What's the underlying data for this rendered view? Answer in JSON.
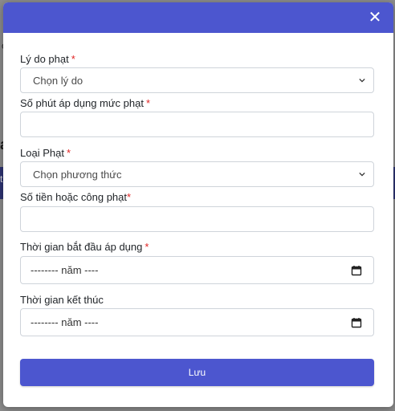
{
  "modal": {
    "close_symbol": "✕",
    "fields": [
      {
        "label": "Lý do phạt",
        "required_mark": "*",
        "type": "select",
        "selected": "Chọn lý do"
      },
      {
        "label": "Số phút áp dụng mức phạt",
        "required_mark": "*",
        "type": "text",
        "value": ""
      },
      {
        "label": "Loại Phạt",
        "required_mark": "*",
        "type": "select",
        "selected": "Chọn phương thức"
      },
      {
        "label": "Số tiền hoặc công phạt",
        "required_mark": "*",
        "type": "text",
        "value": ""
      },
      {
        "label": "Thời gian bắt đầu áp dụng",
        "required_mark": "*",
        "type": "date",
        "value": "-------- năm ----"
      },
      {
        "label": "Thời gian kết thúc",
        "required_mark": "",
        "type": "date",
        "value": "-------- năm ----"
      }
    ],
    "save_label": "Lưu"
  },
  "background": {
    "snippet_1": "a",
    "snippet_2": "t",
    "snippet_3": "t",
    "snippet_4": "o"
  },
  "colors": {
    "accent": "#4c56cf",
    "required": "#e02424",
    "overlay": "#8c8c8c"
  },
  "icons": {
    "close": "close-icon",
    "select": "chevron-down-icon",
    "date": "calendar-icon"
  }
}
